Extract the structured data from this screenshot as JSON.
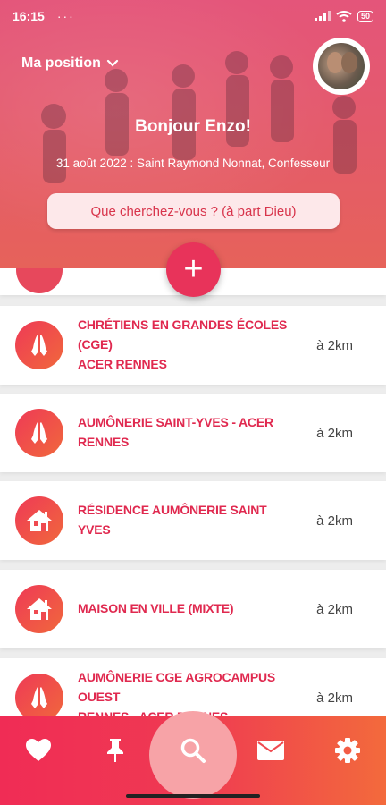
{
  "status_bar": {
    "time": "16:15",
    "dots": "···",
    "battery": "50"
  },
  "header": {
    "position_label": "Ma position",
    "greeting": "Bonjour Enzo!",
    "date_line": "31 août 2022 : Saint Raymond Nonnat, Confesseur",
    "search_placeholder": "Que cherchez-vous ? (à part Dieu)"
  },
  "fab": {
    "label": "+"
  },
  "list": {
    "items": [
      {
        "title_line1": "Chrétiens en Grandes Écoles (CGE)",
        "title_line2": "ACER Rennes",
        "distance": "à 2km",
        "icon": "praying-hands-icon"
      },
      {
        "title_line1": "Aumônerie Saint-Yves - ACER Rennes",
        "title_line2": "",
        "distance": "à 2km",
        "icon": "praying-hands-icon"
      },
      {
        "title_line1": "Résidence Aumônerie Saint Yves",
        "title_line2": "",
        "distance": "à 2km",
        "icon": "house-icon"
      },
      {
        "title_line1": "Maison en Ville (mixte)",
        "title_line2": "",
        "distance": "à 2km",
        "icon": "house-icon"
      },
      {
        "title_line1": "Aumônerie CGE Agrocampus Ouest",
        "title_line2": "Rennes - ACER Rennes",
        "distance": "à 2km",
        "icon": "praying-hands-icon"
      }
    ]
  },
  "bottom_nav": {
    "items": [
      "heart-icon",
      "pin-icon",
      "search-icon",
      "mail-icon",
      "gear-icon"
    ],
    "active": "search-icon"
  },
  "colors": {
    "accent": "#e8335a",
    "title_red": "#e0294f",
    "nav_gradient_start": "#f02c55",
    "nav_gradient_end": "#f36a3c"
  }
}
